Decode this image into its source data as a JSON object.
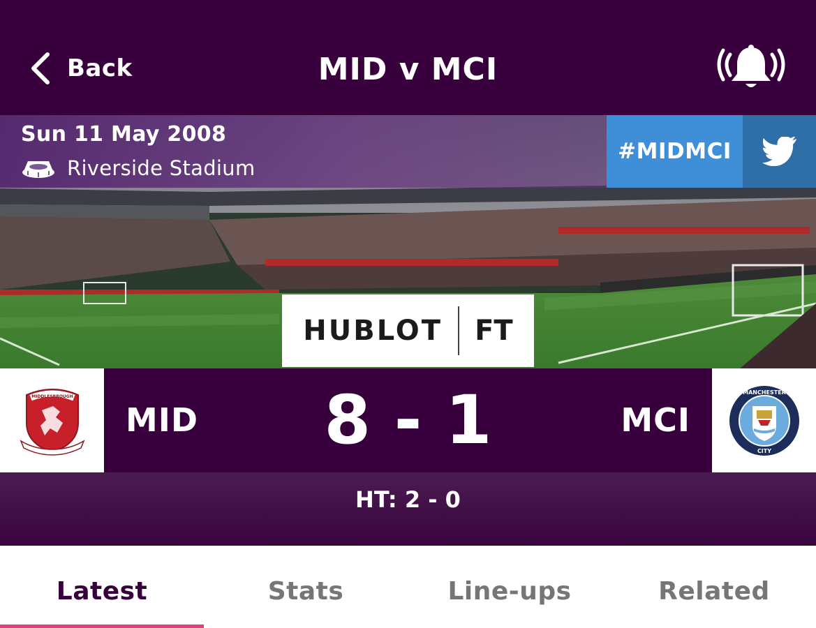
{
  "topbar": {
    "back_label": "Back",
    "title": "MID v MCI",
    "back_icon": "chevron-left-icon",
    "notification_icon": "bell-ringing-icon"
  },
  "match_info": {
    "date": "Sun 11 May 2008",
    "venue": "Riverside Stadium",
    "venue_icon": "stadium-icon",
    "hashtag": "#MIDMCI",
    "share_icon": "twitter-icon"
  },
  "sponsor": {
    "name": "HUBLOT",
    "status": "FT"
  },
  "score": {
    "home": {
      "abbr": "MID",
      "crest_icon": "middlesbrough-crest-icon",
      "crest_text": "MIDDLESBROUGH"
    },
    "away": {
      "abbr": "MCI",
      "crest_icon": "manchester-city-crest-icon",
      "crest_text_top": "MANCHESTER",
      "crest_text_bottom": "CITY"
    },
    "line": "8 - 1",
    "half_time": "HT: 2 - 0"
  },
  "tabs": [
    {
      "label": "Latest",
      "active": true
    },
    {
      "label": "Stats",
      "active": false
    },
    {
      "label": "Line-ups",
      "active": false
    },
    {
      "label": "Related",
      "active": false
    }
  ],
  "colors": {
    "brand_purple": "#37003c",
    "hashtag_blue": "#3f8fd8",
    "twitter_blue": "#2d6fa6",
    "active_tab_underline": "#e0407c",
    "inactive_tab_text": "#767676"
  }
}
